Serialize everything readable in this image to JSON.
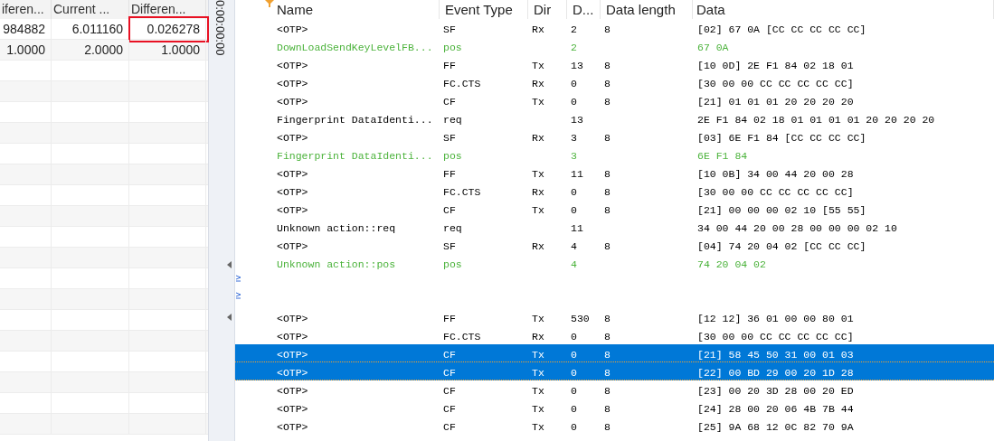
{
  "left_table": {
    "columns": [
      "iferen...",
      "Current ...",
      "Differen..."
    ],
    "rows": [
      [
        {
          "text": "984882",
          "highlighted": false
        },
        {
          "text": "6.011160",
          "highlighted": false
        },
        {
          "text": "0.026278",
          "highlighted": true
        }
      ],
      [
        {
          "text": "1.0000",
          "highlighted": false
        },
        {
          "text": "2.0000",
          "highlighted": false
        },
        {
          "text": "1.0000",
          "highlighted": false
        }
      ]
    ]
  },
  "splitter": {
    "time": "0:00:00:00"
  },
  "trace": {
    "columns": [
      "Name",
      "Event Type",
      "Dir",
      "D...",
      "Data length",
      "Data"
    ],
    "rows": [
      {
        "kind": "frame",
        "selected": false,
        "cells": [
          "<OTP>",
          "SF",
          "Rx",
          "2",
          "8",
          "[02] 67 0A [CC CC CC CC CC]"
        ]
      },
      {
        "kind": "response",
        "selected": false,
        "cells": [
          "DownLoadSendKeyLevelFB...",
          "pos",
          "",
          "2",
          "",
          "67 0A"
        ]
      },
      {
        "kind": "frame",
        "selected": false,
        "cells": [
          "<OTP>",
          "FF",
          "Tx",
          "13",
          "8",
          "[10 0D] 2E F1 84 02 18 01"
        ]
      },
      {
        "kind": "frame",
        "selected": false,
        "cells": [
          "<OTP>",
          "FC.CTS",
          "Rx",
          "0",
          "8",
          "[30 00 00 CC CC CC CC CC]"
        ]
      },
      {
        "kind": "frame",
        "selected": false,
        "cells": [
          "<OTP>",
          "CF",
          "Tx",
          "0",
          "8",
          "[21] 01 01 01 20 20 20 20"
        ]
      },
      {
        "kind": "request",
        "selected": false,
        "cells": [
          "Fingerprint DataIdenti...",
          "req",
          "",
          "13",
          "",
          "2E F1 84 02 18 01 01 01 01 20 20 20 20"
        ]
      },
      {
        "kind": "frame",
        "selected": false,
        "cells": [
          "<OTP>",
          "SF",
          "Rx",
          "3",
          "8",
          "[03] 6E F1 84 [CC CC CC CC]"
        ]
      },
      {
        "kind": "response",
        "selected": false,
        "cells": [
          "Fingerprint DataIdenti...",
          "pos",
          "",
          "3",
          "",
          "6E F1 84"
        ]
      },
      {
        "kind": "frame",
        "selected": false,
        "cells": [
          "<OTP>",
          "FF",
          "Tx",
          "11",
          "8",
          "[10 0B] 34 00 44 20 00 28"
        ]
      },
      {
        "kind": "frame",
        "selected": false,
        "cells": [
          "<OTP>",
          "FC.CTS",
          "Rx",
          "0",
          "8",
          "[30 00 00 CC CC CC CC CC]"
        ]
      },
      {
        "kind": "frame",
        "selected": false,
        "cells": [
          "<OTP>",
          "CF",
          "Tx",
          "0",
          "8",
          "[21] 00 00 00 02 10 [55 55]"
        ]
      },
      {
        "kind": "request",
        "selected": false,
        "cells": [
          "Unknown action::req",
          "req",
          "",
          "11",
          "",
          "34 00 44 20 00 28 00 00 00 02 10"
        ]
      },
      {
        "kind": "frame",
        "selected": false,
        "cells": [
          "<OTP>",
          "SF",
          "Rx",
          "4",
          "8",
          "[04] 74 20 04 02 [CC CC CC]"
        ]
      },
      {
        "kind": "response",
        "selected": false,
        "cells": [
          "Unknown action::pos",
          "pos",
          "",
          "4",
          "",
          "74 20 04 02"
        ]
      },
      {
        "kind": "gap",
        "cells": []
      },
      {
        "kind": "gap",
        "cells": []
      },
      {
        "kind": "frame",
        "selected": false,
        "cells": [
          "<OTP>",
          "FF",
          "Tx",
          "530",
          "8",
          "[12 12] 36 01 00 00 80 01"
        ]
      },
      {
        "kind": "frame",
        "selected": false,
        "cells": [
          "<OTP>",
          "FC.CTS",
          "Rx",
          "0",
          "8",
          "[30 00 00 CC CC CC CC CC]"
        ]
      },
      {
        "kind": "frame",
        "selected": true,
        "cells": [
          "<OTP>",
          "CF",
          "Tx",
          "0",
          "8",
          "[21] 58 45 50 31 00 01 03"
        ]
      },
      {
        "kind": "frame",
        "selected": true,
        "cells": [
          "<OTP>",
          "CF",
          "Tx",
          "0",
          "8",
          "[22] 00 BD 29 00 20 1D 28"
        ]
      },
      {
        "kind": "frame",
        "selected": false,
        "cells": [
          "<OTP>",
          "CF",
          "Tx",
          "0",
          "8",
          "[23] 00 20 3D 28 00 20 ED"
        ]
      },
      {
        "kind": "frame",
        "selected": false,
        "cells": [
          "<OTP>",
          "CF",
          "Tx",
          "0",
          "8",
          "[24] 28 00 20 06 4B 7B 44"
        ]
      },
      {
        "kind": "frame",
        "selected": false,
        "cells": [
          "<OTP>",
          "CF",
          "Tx",
          "0",
          "8",
          "[25] 9A 68 12 0C 82 70 9A"
        ]
      }
    ]
  }
}
